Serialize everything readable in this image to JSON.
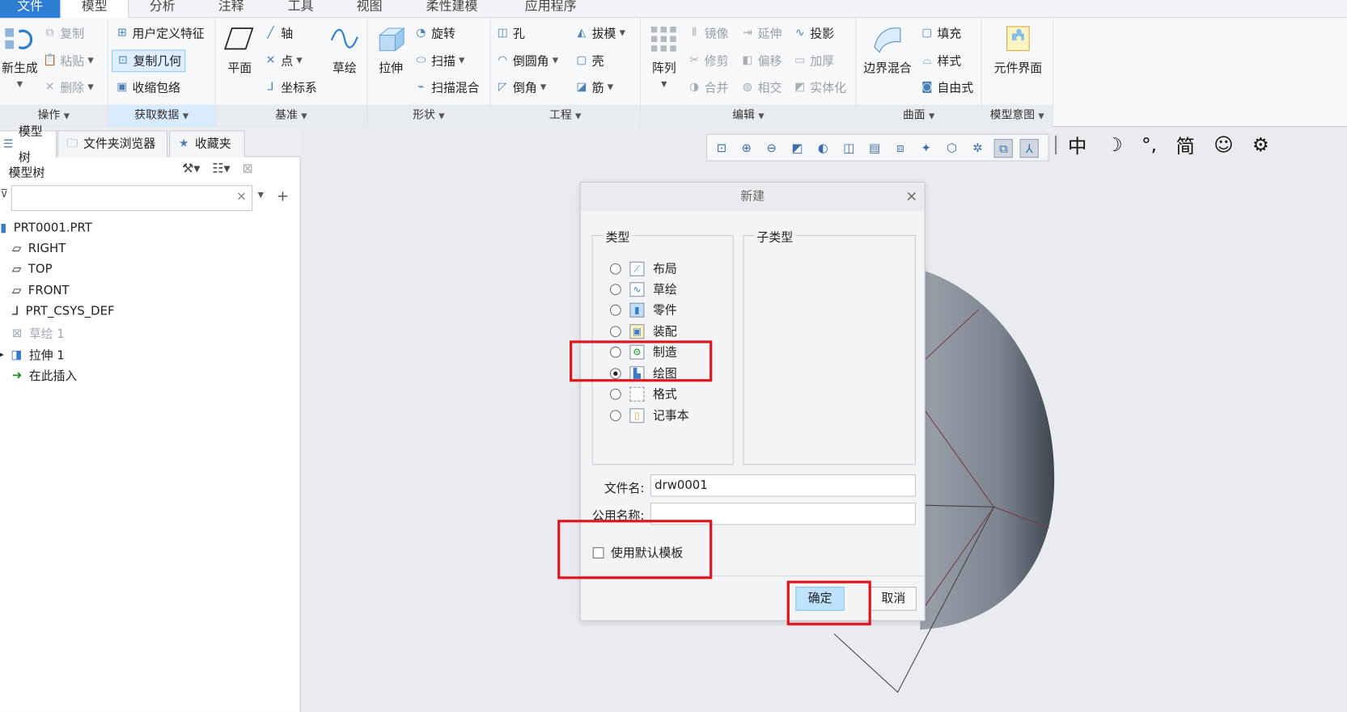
{
  "tabs": [
    "文件",
    "模型",
    "分析",
    "注释",
    "工具",
    "视图",
    "柔性建模",
    "应用程序"
  ],
  "ribbon": {
    "ops": {
      "regen": "新生成",
      "copy": "复制",
      "paste": "粘贴",
      "delete": "删除",
      "group": "操作"
    },
    "getdata": {
      "udf": "用户定义特征",
      "copygeom": "复制几何",
      "shrink": "收缩包络",
      "group": "获取数据"
    },
    "datum": {
      "plane": "平面",
      "axis": "轴",
      "point": "点",
      "csys": "坐标系",
      "sketch": "草绘",
      "group": "基准"
    },
    "shapes": {
      "extrude": "拉伸",
      "revolve": "旋转",
      "sweep": "扫描",
      "sweepblend": "扫描混合",
      "group": "形状"
    },
    "eng": {
      "hole": "孔",
      "round": "倒圆角",
      "chamfer": "倒角",
      "draft": "拔模",
      "shell": "壳",
      "rib": "筋",
      "group": "工程"
    },
    "edit": {
      "pattern": "阵列",
      "mirror": "镜像",
      "extend": "延伸",
      "project": "投影",
      "trim": "修剪",
      "offset": "偏移",
      "thicken": "加厚",
      "merge": "合并",
      "intersect": "相交",
      "solidify": "实体化",
      "group": "编辑"
    },
    "surf": {
      "boundary": "边界混合",
      "fill": "填充",
      "style": "样式",
      "freestyle": "自由式",
      "group": "曲面"
    },
    "intent": {
      "component": "元件界面",
      "group": "模型意图"
    }
  },
  "leftpanel": {
    "tabs": [
      "模型树",
      "文件夹浏览器",
      "收藏夹"
    ],
    "title": "模型树",
    "tree": [
      {
        "label": "PRT0001.PRT",
        "icon": "part-icon"
      },
      {
        "label": "RIGHT",
        "icon": "datum-plane-icon"
      },
      {
        "label": "TOP",
        "icon": "datum-plane-icon"
      },
      {
        "label": "FRONT",
        "icon": "datum-plane-icon"
      },
      {
        "label": "PRT_CSYS_DEF",
        "icon": "csys-icon"
      },
      {
        "label": "草绘 1",
        "icon": "sketch-icon"
      },
      {
        "label": "拉伸 1",
        "icon": "extrude-icon"
      },
      {
        "label": "在此插入",
        "icon": "insert-arrow-icon"
      }
    ]
  },
  "ime": [
    "中",
    "☽",
    "°,",
    "简",
    "☺",
    "⚙"
  ],
  "dialog": {
    "title": "新建",
    "close": "×",
    "type_label": "类型",
    "subtype_label": "子类型",
    "types": [
      {
        "label": "布局",
        "checked": false
      },
      {
        "label": "草绘",
        "checked": false
      },
      {
        "label": "零件",
        "checked": false
      },
      {
        "label": "装配",
        "checked": false
      },
      {
        "label": "制造",
        "checked": false
      },
      {
        "label": "绘图",
        "checked": true
      },
      {
        "label": "格式",
        "checked": false
      },
      {
        "label": "记事本",
        "checked": false
      }
    ],
    "filename_label": "文件名:",
    "filename_value": "drw0001",
    "common_label": "公用名称:",
    "common_value": "",
    "default_template": "使用默认模板",
    "ok": "确定",
    "cancel": "取消"
  },
  "colors": {
    "accent": "#2d7dd2",
    "highlight": "#e0141c"
  }
}
